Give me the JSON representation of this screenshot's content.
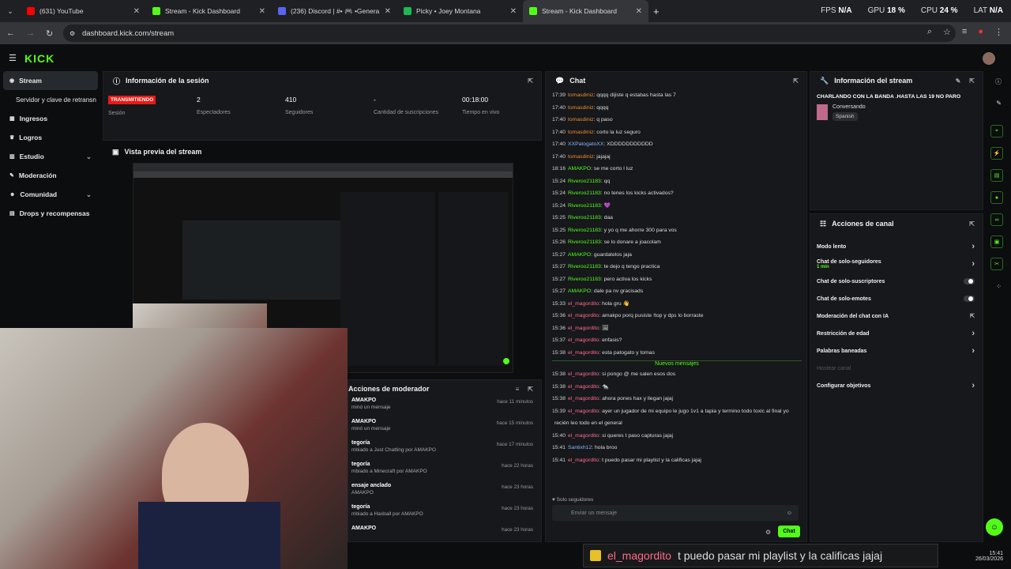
{
  "browser": {
    "tabs": [
      {
        "title": "(631) YouTube",
        "color": "#ff0000",
        "active": false
      },
      {
        "title": "Stream - Kick Dashboard",
        "color": "#53fc18",
        "active": false
      },
      {
        "title": "(236) Discord | #• 🎮 •Genera",
        "color": "#5865f2",
        "active": false
      },
      {
        "title": "Picky • Joey Montana",
        "color": "#1db954",
        "active": false
      },
      {
        "title": "Stream - Kick Dashboard",
        "color": "#53fc18",
        "active": true
      }
    ],
    "new_tab": "+",
    "stats": {
      "fps_label": "FPS",
      "fps": "N/A",
      "gpu_label": "GPU",
      "gpu": "18 %",
      "cpu_label": "CPU",
      "cpu": "24 %",
      "lat_label": "LAT",
      "lat": "N/A"
    },
    "url": "dashboard.kick.com/stream"
  },
  "kick": {
    "logo": "KICK",
    "sidebar": [
      {
        "label": "Stream",
        "icon": "broadcast-icon",
        "selected": true
      },
      {
        "label": "Servidor y clave de retransn",
        "sub": true
      },
      {
        "label": "Ingresos",
        "icon": "money-icon"
      },
      {
        "label": "Logros",
        "icon": "trophy-icon"
      },
      {
        "label": "Estudio",
        "icon": "studio-icon",
        "chevron": true
      },
      {
        "label": "Moderación",
        "icon": "wrench-icon"
      },
      {
        "label": "Comunidad",
        "icon": "users-icon",
        "chevron": true
      },
      {
        "label": "Drops y recompensas",
        "icon": "gift-icon"
      }
    ],
    "session": {
      "title": "Información de la sesión",
      "live_badge": "TRANSMITIENDO",
      "session_label": "Sesión",
      "stats": [
        {
          "value": "2",
          "label": "Espectadores"
        },
        {
          "value": "410",
          "label": "Seguidores"
        },
        {
          "value": "-",
          "label": "Cantidad de suscripciones"
        },
        {
          "value": "00:18:00",
          "label": "Tiempo en vivo"
        }
      ]
    },
    "preview": {
      "title": "Vista previa del stream"
    },
    "chat": {
      "title": "Chat",
      "messages": [
        {
          "t": "17:39",
          "u": "tomasdiniz",
          "c": "u-or",
          "m": "qqqq dijiste q estabas hasta las 7"
        },
        {
          "t": "17:40",
          "u": "tomasdiniz",
          "c": "u-or",
          "m": "qqqq"
        },
        {
          "t": "17:40",
          "u": "tomasdiniz",
          "c": "u-or",
          "m": "q paso"
        },
        {
          "t": "17:40",
          "u": "tomasdiniz",
          "c": "u-or",
          "m": "corto la luz seguro"
        },
        {
          "t": "17:40",
          "u": "XXPatogatoXX",
          "c": "u-bl",
          "m": "XDDDDDDDDDDD"
        },
        {
          "t": "17:40",
          "u": "tomasdiniz",
          "c": "u-or",
          "m": "jajajaj"
        },
        {
          "t": "18:16",
          "u": "AMAKPO",
          "c": "u-gr",
          "m": "se me corto l luz"
        },
        {
          "t": "15:24",
          "u": "Riveroo21183",
          "c": "u-gr",
          "m": "qq"
        },
        {
          "t": "15:24",
          "u": "Riveroo21183",
          "c": "u-gr",
          "m": "no tenes los kicks activados?"
        },
        {
          "t": "15:24",
          "u": "Riveroo21183",
          "c": "u-gr",
          "m": "💜"
        },
        {
          "t": "15:25",
          "u": "Riveroo21183",
          "c": "u-gr",
          "m": "daa"
        },
        {
          "t": "15:25",
          "u": "Riveroo21183",
          "c": "u-gr",
          "m": "y yo q me ahorre 300 para vos"
        },
        {
          "t": "15:26",
          "u": "Riveroo21183",
          "c": "u-gr",
          "m": "se lo donare a joacolam"
        },
        {
          "t": "15:27",
          "u": "AMAKPO",
          "c": "u-gr",
          "m": "guardatelos jaja"
        },
        {
          "t": "15:27",
          "u": "Riveroo21183",
          "c": "u-gr",
          "m": "te dejo q tengo practica"
        },
        {
          "t": "15:27",
          "u": "Riveroo21183",
          "c": "u-gr",
          "m": "pero activa los kicks"
        },
        {
          "t": "15:27",
          "u": "AMAKPO",
          "c": "u-gr",
          "m": "dale pa nv gracisads"
        },
        {
          "t": "15:33",
          "u": "el_magordito",
          "c": "u-pk",
          "m": "hola gru 👋"
        },
        {
          "t": "15:36",
          "u": "el_magordito",
          "c": "u-pk",
          "m": "amakpo porq pusiste !top y dps lo borraste"
        },
        {
          "t": "15:36",
          "u": "el_magordito",
          "c": "u-pk",
          "m": "🖼"
        },
        {
          "t": "15:37",
          "u": "el_magordito",
          "c": "u-pk",
          "m": "enfasis?"
        },
        {
          "t": "15:38",
          "u": "el_magordito",
          "c": "u-pk",
          "m": "esta patogato y tomas"
        }
      ],
      "new_label": "Nuevos mensajes",
      "new_messages": [
        {
          "t": "15:38",
          "u": "el_magordito",
          "c": "u-pk",
          "m": "si pongo @ me salen esos dos"
        },
        {
          "t": "15:38",
          "u": "el_magordito",
          "c": "u-pk",
          "m": "🐀"
        },
        {
          "t": "15:38",
          "u": "el_magordito",
          "c": "u-pk",
          "m": "ahora pones hax y llegan jajaj"
        },
        {
          "t": "15:39",
          "u": "el_magordito",
          "c": "u-pk",
          "m": "ayer un jugador de mi equipo le jugo 1v1 a tapia y termino todo toxic al final yo"
        },
        {
          "t": "",
          "u": "",
          "c": "",
          "m": "recién leo todo en el general"
        },
        {
          "t": "15:40",
          "u": "el_magordito",
          "c": "u-pk",
          "m": "si queres t paso capturas jajaj"
        },
        {
          "t": "15:41",
          "u": "Santixh12",
          "c": "u-bl",
          "m": "hola broo"
        },
        {
          "t": "15:41",
          "u": "el_magordito",
          "c": "u-pk",
          "m": "t puedo pasar mi playlist y la calificas jajaj"
        }
      ],
      "followers_only": "Solo seguidores",
      "input_placeholder": "Enviar un mensaje",
      "send_label": "Chat"
    },
    "stream_info": {
      "title": "Información del stream",
      "stream_title": "CHARLANDO CON LA BANDA .HASTA LAS 19 NO PARO",
      "category": "Conversando",
      "language": "Spanish"
    },
    "channel_actions": {
      "title": "Acciones de canal",
      "items": [
        {
          "label": "Modo lento",
          "kind": "chevron"
        },
        {
          "label": "Chat de solo-seguidores",
          "sub": "1 min",
          "kind": "chevron"
        },
        {
          "label": "Chat de solo-suscriptores",
          "kind": "toggle"
        },
        {
          "label": "Chat de solo-emotes",
          "kind": "toggle"
        },
        {
          "label": "Moderación del chat con IA",
          "kind": "external"
        },
        {
          "label": "Restricción de edad",
          "kind": "chevron"
        },
        {
          "label": "Palabras baneadas",
          "kind": "chevron"
        },
        {
          "label": "Hostear canal",
          "kind": "disabled"
        },
        {
          "label": "Configurar objetivos",
          "kind": "chevron"
        }
      ]
    },
    "mod_actions": {
      "title": "Acciones de moderador",
      "rows": [
        {
          "a": "AMAKPO",
          "b": "minó un mensaje",
          "time": "hace 11 minutos"
        },
        {
          "a": "AMAKPO",
          "b": "minó un mensaje",
          "time": "hace 15 minutos"
        },
        {
          "a": "tegoría",
          "b": "mbiado a Just Chatting por AMAKPO",
          "time": "hace 17 minutos"
        },
        {
          "a": "tegoría",
          "b": "mbiado a Minecraft por AMAKPO",
          "time": "hace 22 horas"
        },
        {
          "a": "ensaje anclado",
          "b": "AMAKPO",
          "time": "hace 23 horas"
        },
        {
          "a": "tegoría",
          "b": "mbiado a Haxball por AMAKPO",
          "time": "hace 23 horas"
        },
        {
          "a": "AMAKPO",
          "b": "",
          "time": "hace 23 horas"
        }
      ]
    }
  },
  "overlay": {
    "user": "el_magordito",
    "text": "t puedo pasar mi playlist y la calificas jajaj"
  },
  "clock": {
    "time": "15:41",
    "date": "26/03/2026"
  }
}
